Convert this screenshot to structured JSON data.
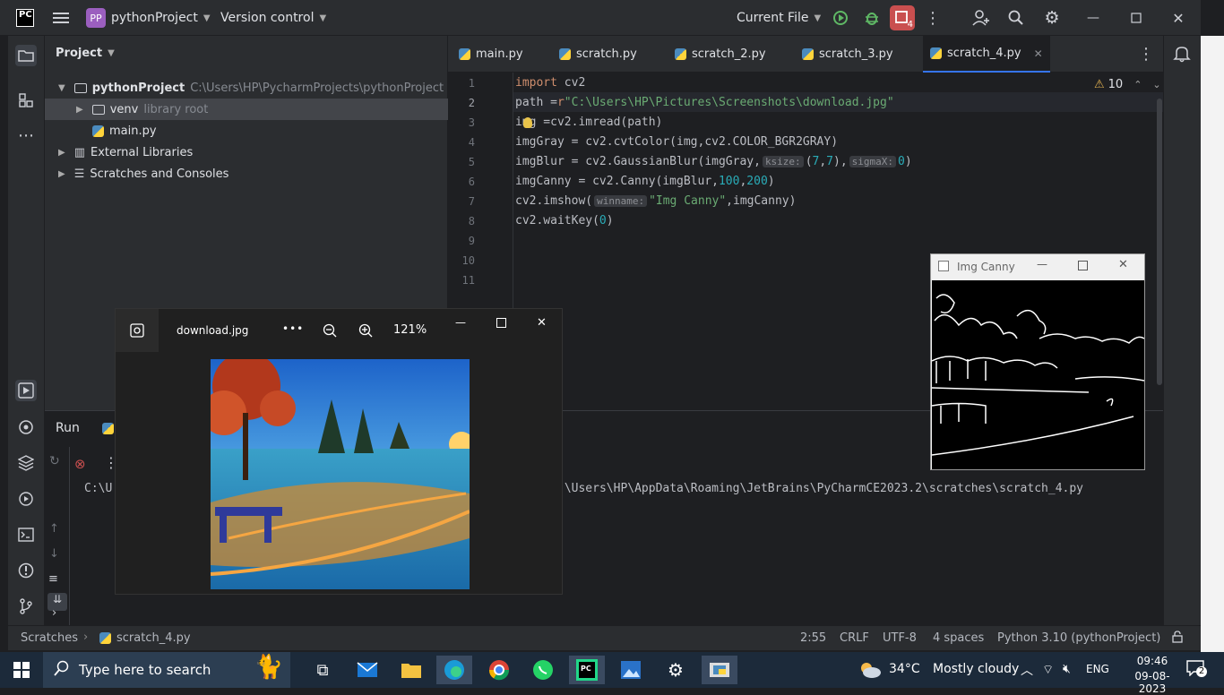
{
  "title_bar": {
    "logo": "PC",
    "project_badge": "PP",
    "project_name": "pythonProject",
    "version_control": "Version control",
    "run_config": "Current File",
    "notification_count": "4"
  },
  "project_panel": {
    "title": "Project",
    "tree": [
      {
        "name": "pythonProject",
        "detail": "C:\\Users\\HP\\PycharmProjects\\pythonProject"
      },
      {
        "name": "venv",
        "detail": "library root"
      },
      {
        "name": "main.py",
        "detail": ""
      },
      {
        "name": "External Libraries",
        "detail": ""
      },
      {
        "name": "Scratches and Consoles",
        "detail": ""
      }
    ]
  },
  "editor": {
    "tabs": [
      "main.py",
      "scratch.py",
      "scratch_2.py",
      "scratch_3.py",
      "scratch_4.py"
    ],
    "active_tab": "scratch_4.py",
    "warning_count": "10",
    "line_numbers": [
      "1",
      "2",
      "3",
      "4",
      "5",
      "6",
      "7",
      "8",
      "9",
      "10",
      "11"
    ],
    "code": {
      "l1_kw": "import",
      "l1_rest": " cv2",
      "l2_a": "path =",
      "l2_prefix": "r",
      "l2_str": "\"C:\\Users\\HP\\Pictures\\Screenshots\\download.jpg\"",
      "l3": "img =cv2.imread(path)",
      "l4": "imgGray = cv2.cvtColor(img,cv2.COLOR_BGR2GRAY)",
      "l5_a": "imgBlur = cv2.GaussianBlur(imgGray,",
      "l5_hint1": "ksize:",
      "l5_b": "(",
      "l5_n1": "7",
      "l5_c": ",",
      "l5_n2": "7",
      "l5_d": "),",
      "l5_hint2": "sigmaX:",
      "l5_n3": "0",
      "l5_e": ")",
      "l6_a": "imgCanny = cv2.Canny(imgBlur,",
      "l6_n1": "100",
      "l6_b": ",",
      "l6_n2": "200",
      "l6_c": ")",
      "l7_a": "cv2.imshow(",
      "l7_hint": "winname:",
      "l7_str": "\"Img Canny\"",
      "l7_b": ",imgCanny)",
      "l8_a": "cv2.waitKey(",
      "l8_n": "0",
      "l8_b": ")"
    }
  },
  "run_panel": {
    "title": "Run",
    "output_left": "C:\\U",
    "output_right": ":\\Users\\HP\\AppData\\Roaming\\JetBrains\\PyCharmCE2023.2\\scratches\\scratch_4.py"
  },
  "photos_window": {
    "filename": "download.jpg",
    "more": "•••",
    "zoom": "121%"
  },
  "canny_window": {
    "title": "Img Canny"
  },
  "status_bar": {
    "breadcrumb_root": "Scratches",
    "breadcrumb_file": "scratch_4.py",
    "position": "2:55",
    "line_sep": "CRLF",
    "encoding": "UTF-8",
    "indent": "4 spaces",
    "interpreter": "Python 3.10 (pythonProject)"
  },
  "taskbar": {
    "search_placeholder": "Type here to search",
    "temperature": "34°C",
    "weather": "Mostly cloudy",
    "language": "ENG",
    "time": "09:46",
    "date": "09-08-2023",
    "notification_count": "2"
  }
}
